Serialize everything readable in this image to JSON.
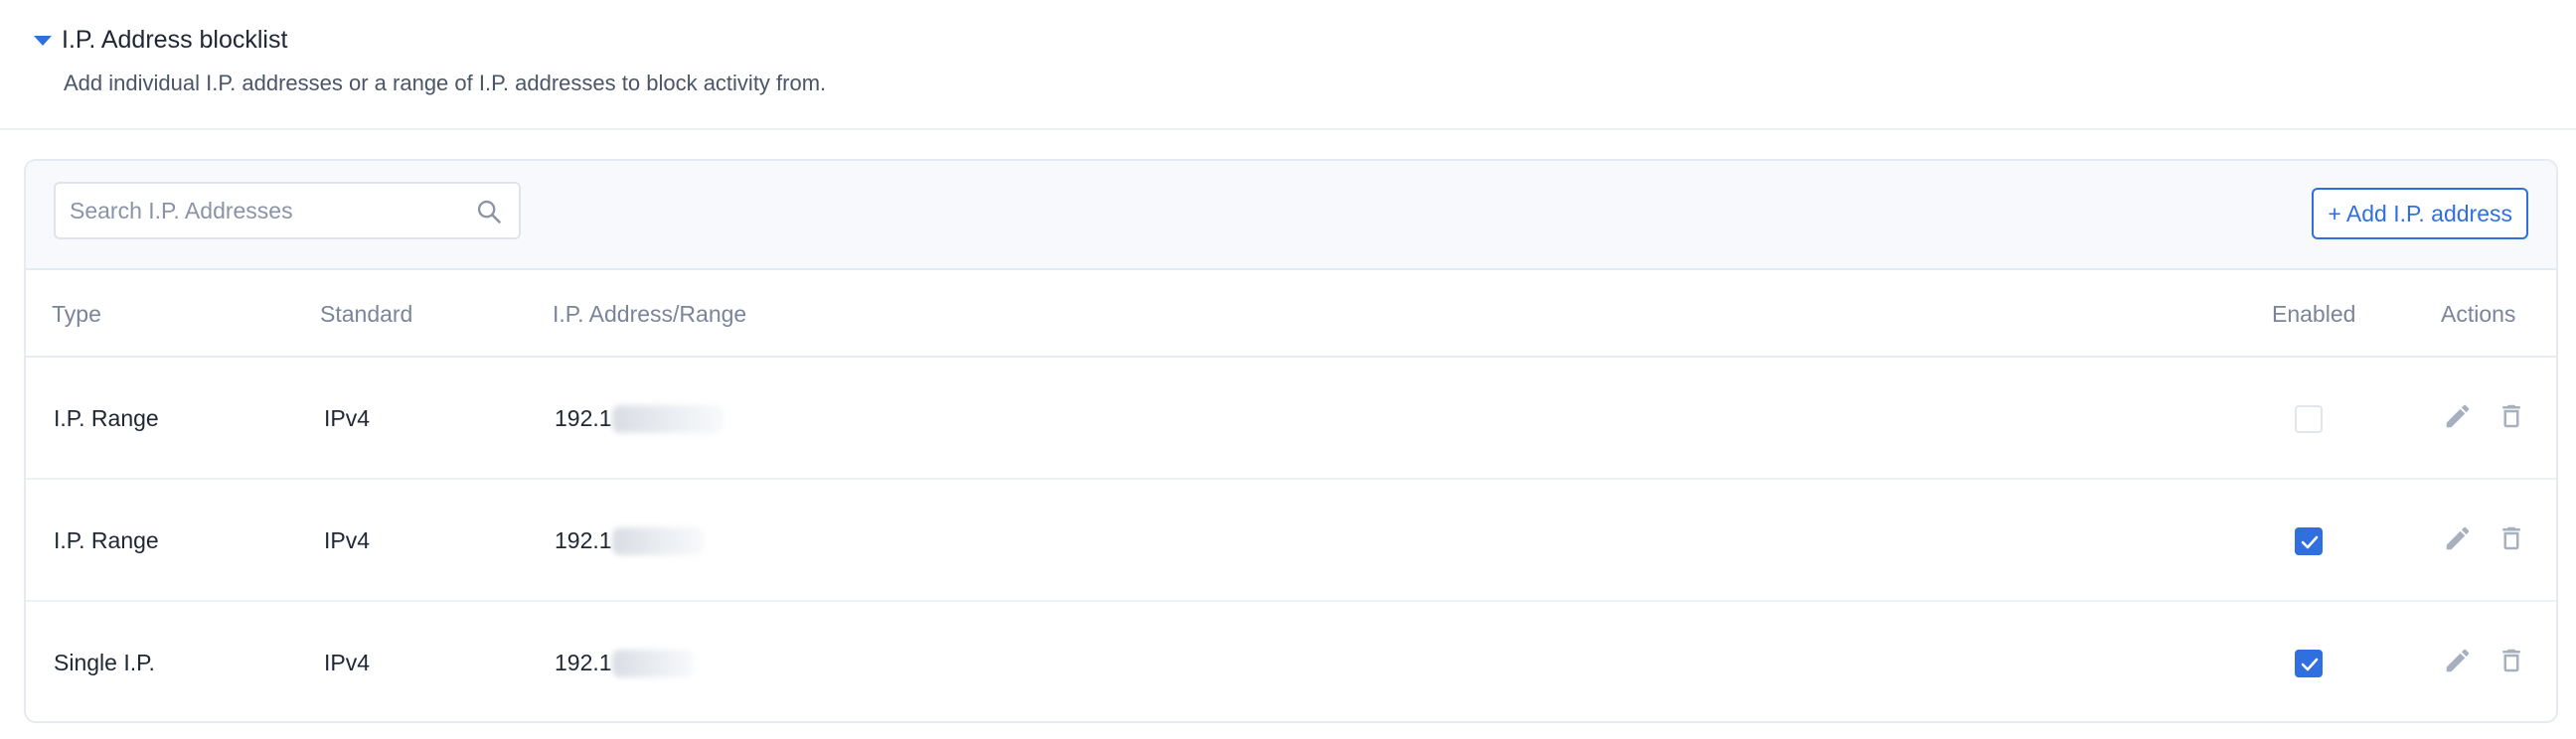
{
  "section": {
    "title": "I.P. Address blocklist",
    "description": "Add individual I.P. addresses or a range of I.P. addresses to block activity from."
  },
  "toolbar": {
    "search_placeholder": "Search I.P. Addresses",
    "add_label": "+ Add I.P. address"
  },
  "table": {
    "columns": {
      "type": "Type",
      "standard": "Standard",
      "address": "I.P. Address/Range",
      "enabled": "Enabled",
      "actions": "Actions"
    },
    "rows": [
      {
        "type": "I.P. Range",
        "standard": "IPv4",
        "address_visible": "192.1",
        "enabled": false
      },
      {
        "type": "I.P. Range",
        "standard": "IPv4",
        "address_visible": "192.1",
        "enabled": true
      },
      {
        "type": "Single I.P.",
        "standard": "IPv4",
        "address_visible": "192.1",
        "enabled": true
      }
    ]
  },
  "colors": {
    "accent": "#2f6fe0",
    "muted_text": "#7a8599",
    "icon_gray": "#a7b0bf"
  },
  "icons": {
    "toggle": "caret-down-icon",
    "search": "search-icon",
    "edit": "pencil-icon",
    "delete": "trash-icon",
    "check": "check-icon"
  }
}
